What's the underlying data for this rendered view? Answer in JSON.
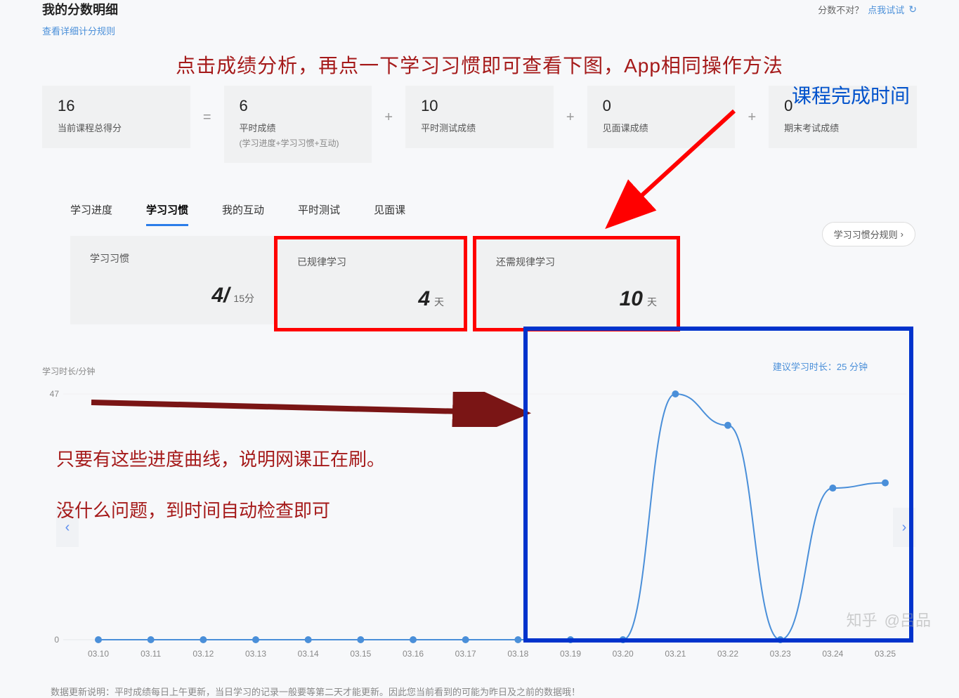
{
  "header": {
    "title": "我的分数明细",
    "feedback_prefix": "分数不对？",
    "feedback_link": "点我试试",
    "rules_link": "查看详细计分规则"
  },
  "annotations": {
    "top_red": "点击成绩分析，再点一下学习习惯即可查看下图，App相同操作方法",
    "top_blue": "课程完成时间",
    "mid_line1": "只要有这些进度曲线，说明网课正在刷。",
    "mid_line2": "没什么问题，到时间自动检查即可"
  },
  "scores": {
    "s1": {
      "value": "16",
      "label": "当前课程总得分"
    },
    "op1": "=",
    "s2": {
      "value": "6",
      "label": "平时成绩",
      "sub": "(学习进度+学习习惯+互动)"
    },
    "op2": "+",
    "s3": {
      "value": "10",
      "label": "平时测试成绩"
    },
    "op3": "+",
    "s4": {
      "value": "0",
      "label": "见面课成绩"
    },
    "op4": "+",
    "s5": {
      "value": "0",
      "label": "期末考试成绩"
    }
  },
  "tabs": {
    "t1": "学习进度",
    "t2": "学习习惯",
    "t3": "我的互动",
    "t4": "平时测试",
    "t5": "见面课"
  },
  "habit": {
    "card1_title": "学习习惯",
    "card1_val": "4/",
    "card1_unit": "15分",
    "card2_title": "已规律学习",
    "card2_val": "4",
    "card2_unit": "天",
    "card3_title": "还需规律学习",
    "card3_val": "10",
    "card3_unit": "天",
    "rules_btn": "学习习惯分规则"
  },
  "chart": {
    "ylabel": "学习时长/分钟",
    "hint": "建议学习时长：25 分钟",
    "ymax": "47",
    "ymin": "0"
  },
  "chart_data": {
    "type": "line",
    "xlabel": "",
    "ylabel": "学习时长/分钟",
    "ylim": [
      0,
      47
    ],
    "categories": [
      "03.10",
      "03.11",
      "03.12",
      "03.13",
      "03.14",
      "03.15",
      "03.16",
      "03.17",
      "03.18",
      "03.19",
      "03.20",
      "03.21",
      "03.22",
      "03.23",
      "03.24",
      "03.25"
    ],
    "values": [
      0,
      0,
      0,
      0,
      0,
      0,
      0,
      0,
      0,
      0,
      0,
      47,
      41,
      0,
      29,
      30
    ],
    "title": ""
  },
  "footer": {
    "note": "数据更新说明：平时成绩每日上午更新，当日学习的记录一般要等第二天才能更新。因此您当前看到的可能为昨日及之前的数据哦！"
  },
  "watermark": {
    "brand": "知乎",
    "user": "@吕品"
  }
}
